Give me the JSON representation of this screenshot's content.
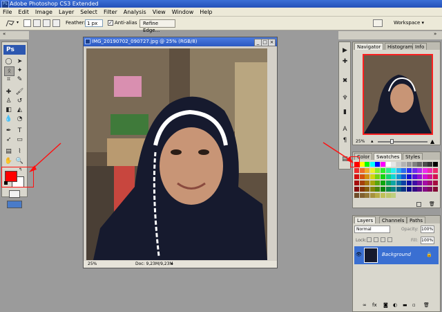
{
  "window": {
    "title": "Adobe Photoshop CS3 Extended",
    "app_icon": "Ps"
  },
  "menu": [
    "File",
    "Edit",
    "Image",
    "Layer",
    "Select",
    "Filter",
    "Analysis",
    "View",
    "Window",
    "Help"
  ],
  "options": {
    "feather_label": "Feather:",
    "feather_value": "1 px",
    "antialias_label": "Anti-alias",
    "antialias_checked": true,
    "refine_edge": "Refine Edge...",
    "workspace": "Workspace ▾"
  },
  "toolbox": {
    "logo": "Ps",
    "foreground_color": "#ff0000",
    "background_color": "#ffffff"
  },
  "document": {
    "title": "IMG_20190702_090727.jpg @ 25% (RGB/8)",
    "zoom": "25%",
    "doc_size": "Doc: 9,23M/9,23M"
  },
  "navigator": {
    "tabs": [
      "Navigator",
      "Histogram",
      "Info"
    ],
    "zoom": "25%"
  },
  "swatches": {
    "tabs": [
      "Color",
      "Swatches",
      "Styles"
    ]
  },
  "layers": {
    "tabs": [
      "Layers",
      "Channels",
      "Paths"
    ],
    "blend_mode": "Normal",
    "opacity_label": "Opacity:",
    "opacity_value": "100%",
    "lock_label": "Lock:",
    "fill_label": "Fill:",
    "fill_value": "100%",
    "layer_name": "Background"
  }
}
